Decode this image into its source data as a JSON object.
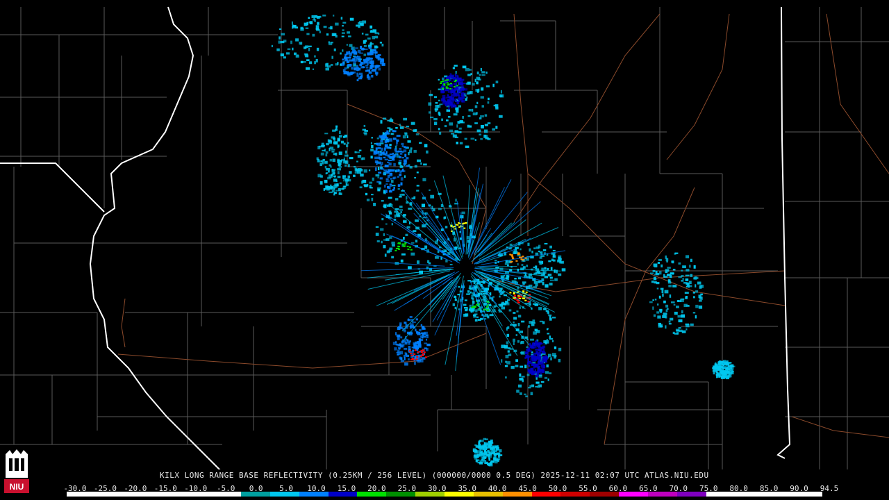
{
  "product": {
    "caption": "KILX LONG RANGE BASE REFLECTIVITY (0.25KM / 256 LEVEL) (000000/0000 0.5 DEG) 2025-12-11 02:07 UTC  ATLAS.NIU.EDU"
  },
  "logo": {
    "text": "NIU",
    "color": "#c8102e"
  },
  "colorbar": {
    "ticks": [
      "-30.0",
      "-25.0",
      "-20.0",
      "-15.0",
      "-10.0",
      "-5.0",
      "0.0",
      "5.0",
      "10.0",
      "15.0",
      "20.0",
      "25.0",
      "30.0",
      "35.0",
      "40.0",
      "45.0",
      "50.0",
      "55.0",
      "60.0",
      "65.0",
      "70.0",
      "75.0",
      "80.0",
      "85.0",
      "90.0",
      "94.5"
    ],
    "colors": [
      "#ffffff",
      "#ffffff",
      "#ffffff",
      "#ffffff",
      "#ffffff",
      "#ffffff",
      "#00a0a0",
      "#00c8f0",
      "#0080ff",
      "#0000c8",
      "#00e000",
      "#009000",
      "#a0d000",
      "#ffff00",
      "#e8c000",
      "#ff9000",
      "#ff0000",
      "#d00000",
      "#a00000",
      "#ff00ff",
      "#c000c0",
      "#8000c0",
      "#ffffff",
      "#ffffff",
      "#ffffff",
      "#ffffff"
    ]
  },
  "palette": {
    "background": "#000000",
    "county_lines": "#5a5a5a",
    "state_lines": "#ffffff",
    "roads": "#8b4a2b"
  }
}
